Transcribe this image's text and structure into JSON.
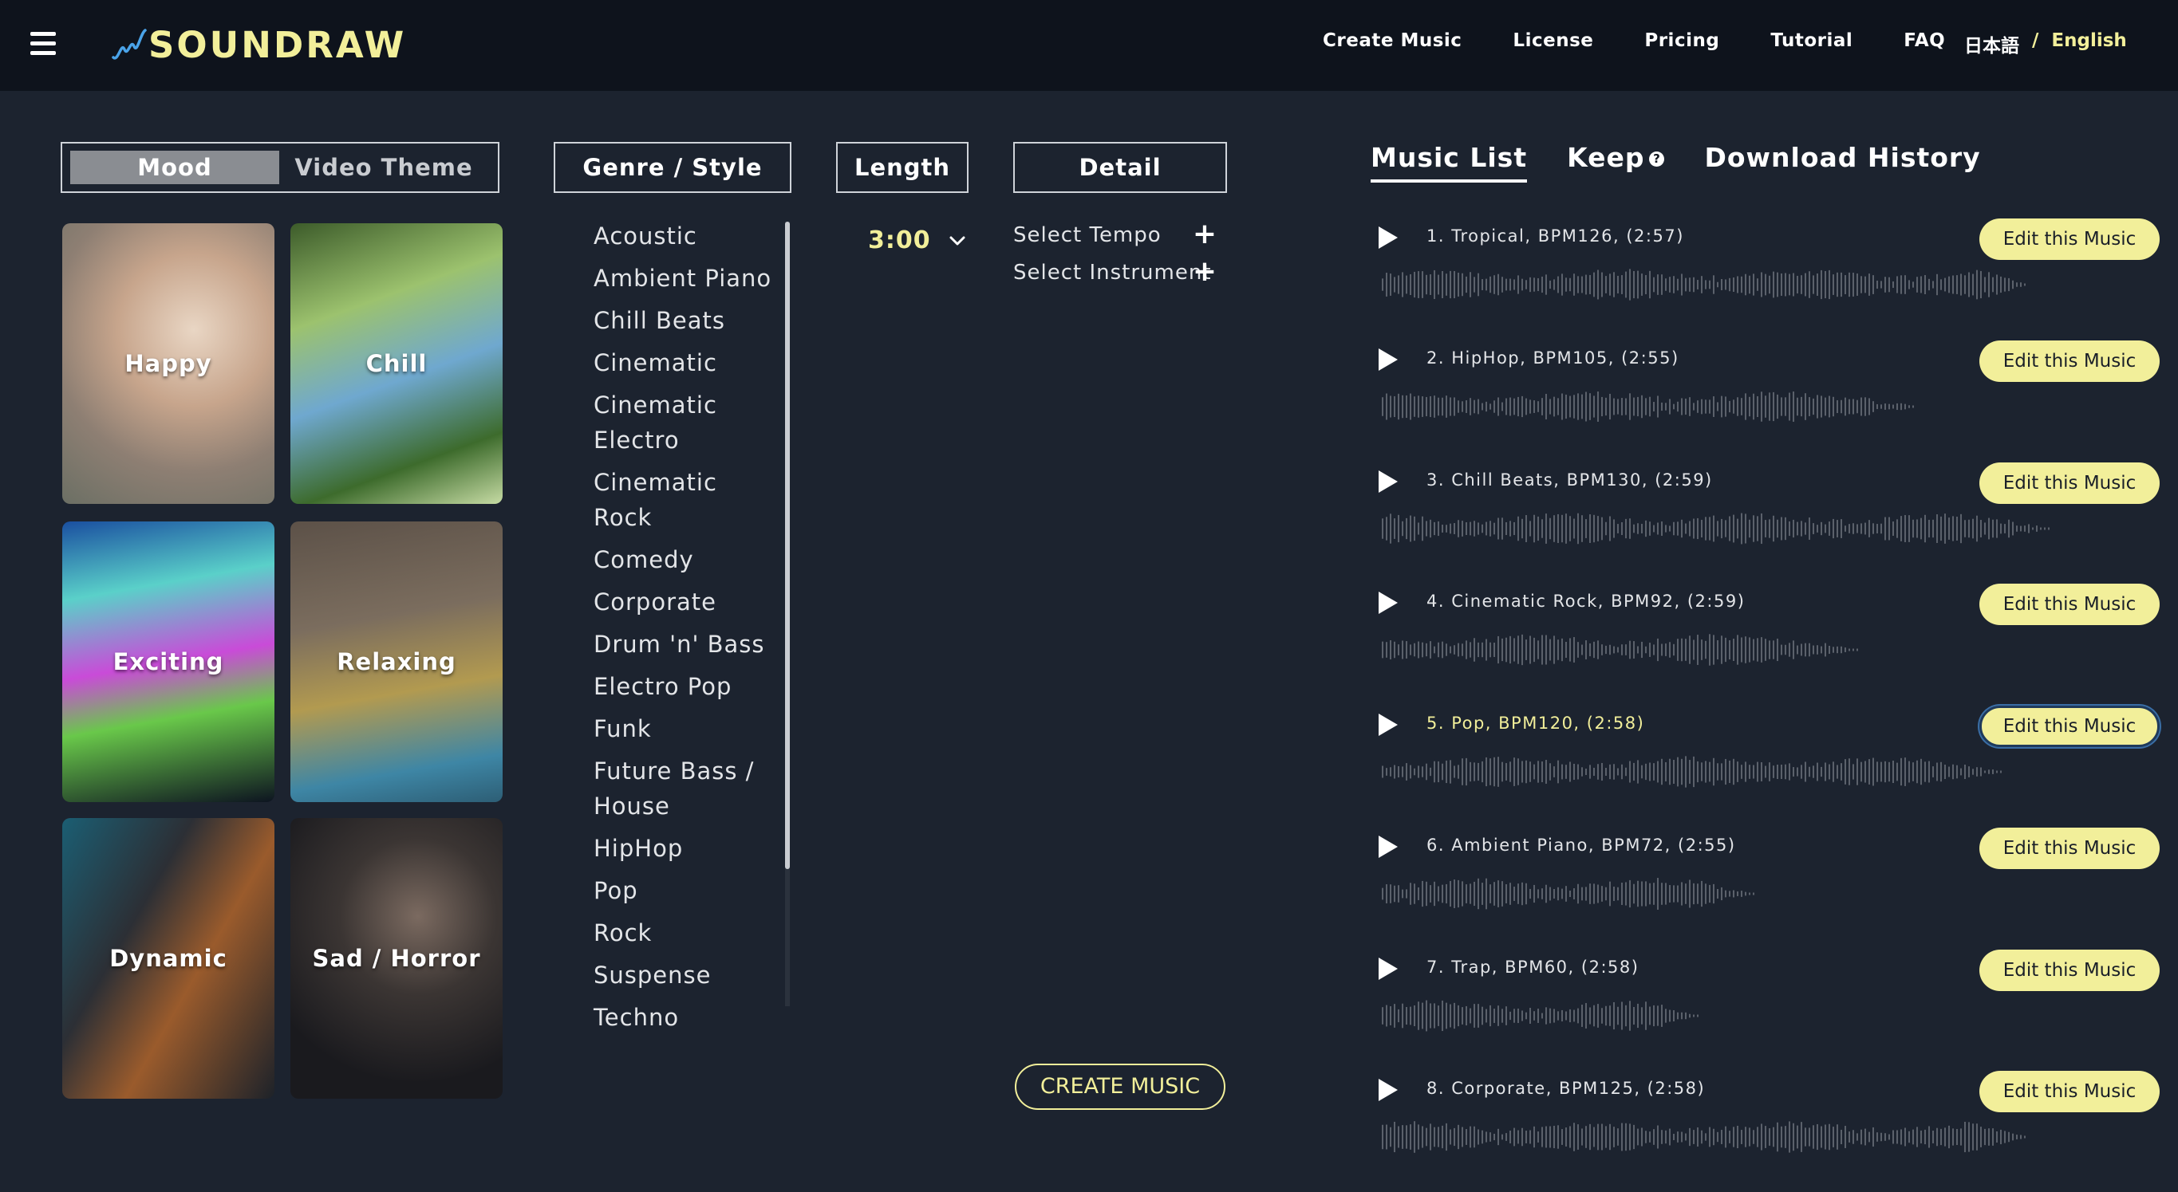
{
  "header": {
    "logo_text": "SOUNDRAW",
    "nav": [
      "Create Music",
      "License",
      "Pricing",
      "Tutorial",
      "FAQ"
    ],
    "lang_ja": "日本語",
    "lang_sep": "/",
    "lang_en": "English"
  },
  "mood": {
    "tab_mood": "Mood",
    "tab_video": "Video Theme",
    "cards": [
      "Happy",
      "Chill",
      "Exciting",
      "Relaxing",
      "Dynamic",
      "Sad / Horror"
    ]
  },
  "genre": {
    "heading": "Genre / Style",
    "items": [
      "Acoustic",
      "Ambient Piano",
      "Chill Beats",
      "Cinematic",
      "Cinematic Electro",
      "Cinematic Rock",
      "Comedy",
      "Corporate",
      "Drum 'n' Bass",
      "Electro Pop",
      "Funk",
      "Future Bass / House",
      "HipHop",
      "Pop",
      "Rock",
      "Suspense",
      "Techno"
    ]
  },
  "length": {
    "heading": "Length",
    "value": "3:00"
  },
  "detail": {
    "heading": "Detail",
    "tempo": "Select Tempo",
    "instrument": "Select Instrument",
    "create_button": "CREATE MUSIC"
  },
  "music_list": {
    "tab_list": "Music List",
    "tab_keep": "Keep",
    "keep_help": "?",
    "tab_history": "Download History",
    "edit_label": "Edit this Music",
    "tracks": [
      "1. Tropical, BPM126, (2:57)",
      "2. HipHop, BPM105, (2:55)",
      "3. Chill Beats, BPM130, (2:59)",
      "4. Cinematic Rock, BPM92, (2:59)",
      "5. Pop, BPM120, (2:58)",
      "6. Ambient Piano, BPM72, (2:55)",
      "7. Trap, BPM60, (2:58)",
      "8. Corporate, BPM125, (2:58)"
    ],
    "selected_index": 4
  },
  "colors": {
    "accent": "#f2ef9a",
    "background": "#1c232f",
    "header_bg": "#0e131c"
  }
}
